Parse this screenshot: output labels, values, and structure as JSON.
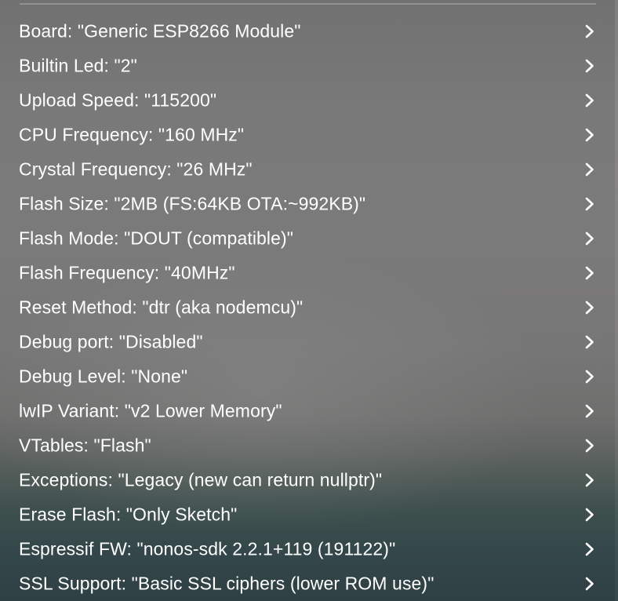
{
  "menu": {
    "items": [
      {
        "label": "Board: \"Generic ESP8266 Module\"",
        "icon": "chevron-right-icon"
      },
      {
        "label": "Builtin Led: \"2\"",
        "icon": "chevron-right-icon"
      },
      {
        "label": "Upload Speed: \"115200\"",
        "icon": "chevron-right-icon"
      },
      {
        "label": "CPU Frequency: \"160 MHz\"",
        "icon": "chevron-right-icon"
      },
      {
        "label": "Crystal Frequency: \"26 MHz\"",
        "icon": "chevron-right-icon"
      },
      {
        "label": "Flash Size: \"2MB (FS:64KB OTA:~992KB)\"",
        "icon": "chevron-right-icon"
      },
      {
        "label": "Flash Mode: \"DOUT (compatible)\"",
        "icon": "chevron-right-icon"
      },
      {
        "label": "Flash Frequency: \"40MHz\"",
        "icon": "chevron-right-icon"
      },
      {
        "label": "Reset Method: \"dtr (aka nodemcu)\"",
        "icon": "chevron-right-icon"
      },
      {
        "label": "Debug port: \"Disabled\"",
        "icon": "chevron-right-icon"
      },
      {
        "label": "Debug Level: \"None\"",
        "icon": "chevron-right-icon"
      },
      {
        "label": "lwIP Variant: \"v2 Lower Memory\"",
        "icon": "chevron-right-icon"
      },
      {
        "label": "VTables: \"Flash\"",
        "icon": "chevron-right-icon"
      },
      {
        "label": "Exceptions: \"Legacy (new can return nullptr)\"",
        "icon": "chevron-right-icon"
      },
      {
        "label": "Erase Flash: \"Only Sketch\"",
        "icon": "chevron-right-icon"
      },
      {
        "label": "Espressif FW: \"nonos-sdk 2.2.1+119 (191122)\"",
        "icon": "chevron-right-icon"
      },
      {
        "label": "SSL Support: \"Basic SSL ciphers (lower ROM use)\"",
        "icon": "chevron-right-icon"
      }
    ]
  }
}
